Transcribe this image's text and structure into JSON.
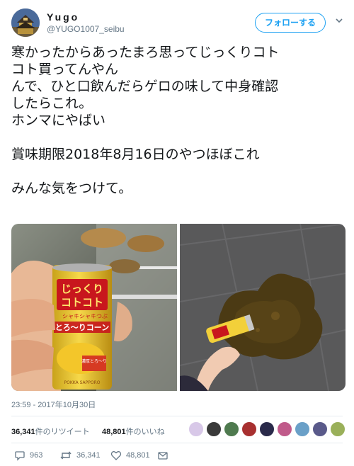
{
  "user": {
    "display_name": "Yugo",
    "handle": "@YUGO1007_seibu",
    "avatar_icon": "castle-avatar"
  },
  "follow_button": {
    "label": "フォローする"
  },
  "tweet": {
    "lines": [
      "寒かったからあったまろ思ってじっくりコト",
      "コト買ってんやん",
      "んで、ひと口飲んだらゲロの味して中身確認",
      "したらこれ。",
      "ホンマにやばい",
      "",
      "賞味期限2018年8月16日のやつほぼこれ",
      "",
      "みんな気をつけて。"
    ]
  },
  "media": {
    "can_text": [
      "じっくり",
      "コトコト",
      "シャキシャキつぶ",
      "とろ〜りコーン",
      "濃厚とろ〜り",
      "POKKA SAPPORO"
    ]
  },
  "timestamp": "23:59 - 2017年10月30日",
  "stats": {
    "retweets_count": "36,341",
    "retweets_label": "件のリツイート",
    "likes_count": "48,801",
    "likes_label": "件のいいね"
  },
  "actions": {
    "reply_count": "963",
    "retweet_count": "36,341",
    "like_count": "48,801"
  },
  "colors": {
    "accent": "#1da1f2",
    "muted": "#657786",
    "text": "#14171a"
  }
}
